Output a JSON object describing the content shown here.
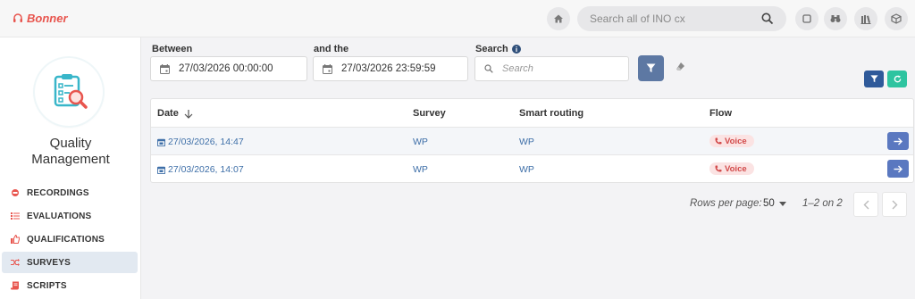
{
  "header": {
    "brand": "Bonner",
    "search_placeholder": "Search all of INO cx",
    "icons": [
      "home-icon",
      "search-icon",
      "square-icon",
      "binoculars-icon",
      "library-icon",
      "cube-icon"
    ]
  },
  "sidebar": {
    "module_title_line1": "Quality",
    "module_title_line2": "Management",
    "items": [
      {
        "label": "RECORDINGS",
        "icon": "record-icon"
      },
      {
        "label": "EVALUATIONS",
        "icon": "list-icon"
      },
      {
        "label": "QUALIFICATIONS",
        "icon": "thumbs-up-icon"
      },
      {
        "label": "SURVEYS",
        "icon": "shuffle-icon",
        "active": true
      },
      {
        "label": "SCRIPTS",
        "icon": "script-icon"
      }
    ]
  },
  "filters": {
    "between_label": "Between",
    "between_value": "27/03/2026 00:00:00",
    "and_label": "and the",
    "and_value": "27/03/2026 23:59:59",
    "search_label": "Search",
    "search_placeholder": "Search"
  },
  "table": {
    "columns": [
      "Date",
      "Survey",
      "Smart routing",
      "Flow"
    ],
    "rows": [
      {
        "date": "27/03/2026, 14:47",
        "survey": "WP",
        "routing": "WP",
        "flow": "Voice"
      },
      {
        "date": "27/03/2026, 14:07",
        "survey": "WP",
        "routing": "WP",
        "flow": "Voice"
      }
    ]
  },
  "pagination": {
    "rows_per_page_label": "Rows per page:",
    "rows_per_page": "50",
    "range": "1–2 on 2"
  },
  "colors": {
    "brand": "#e8554e",
    "primary": "#5a78c0",
    "link": "#3e6fa8",
    "refresh": "#2ec4a0",
    "badge_bg": "#fbe3e3",
    "badge_text": "#d24a4a"
  }
}
